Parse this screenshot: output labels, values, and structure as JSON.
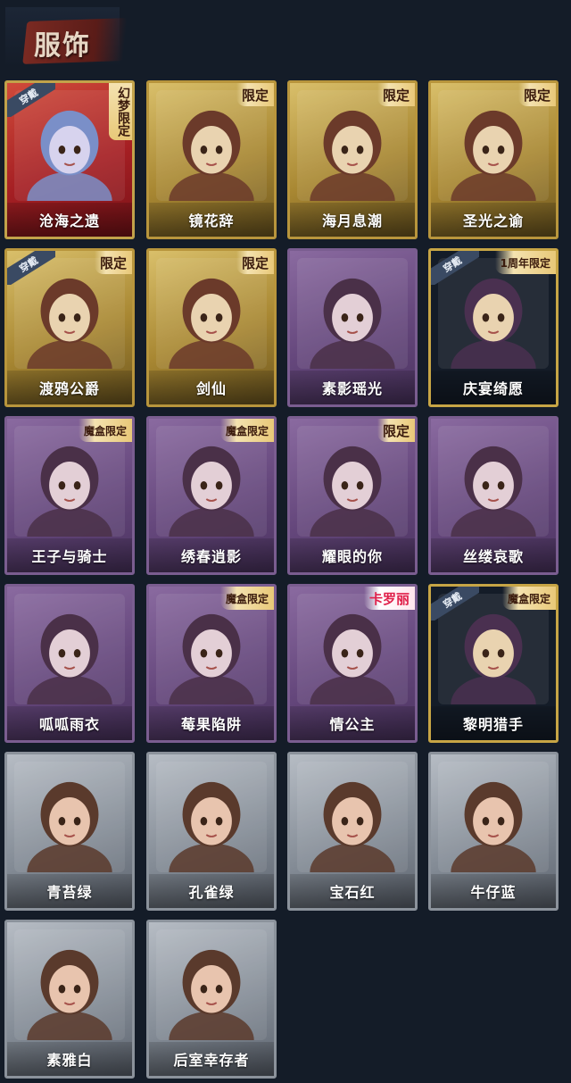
{
  "header": {
    "title": "服饰"
  },
  "colors": {
    "background": "#141c28",
    "red_card": "#a51f23",
    "gold_card": "#a88732",
    "purple_card": "#65477c",
    "gray_card": "#858d97"
  },
  "costumes": [
    {
      "name": "沧海之遗",
      "tag": "幻梦限定",
      "equipped_label": "穿戴",
      "style": "red"
    },
    {
      "name": "镜花辞",
      "tag": "限定",
      "style": "gold"
    },
    {
      "name": "海月息潮",
      "tag": "限定",
      "style": "gold"
    },
    {
      "name": "圣光之谕",
      "tag": "限定",
      "style": "gold"
    },
    {
      "name": "渡鸦公爵",
      "tag": "限定",
      "equipped_label": "穿戴",
      "style": "gold"
    },
    {
      "name": "剑仙",
      "tag": "限定",
      "style": "gold"
    },
    {
      "name": "素影瑶光",
      "style": "purple"
    },
    {
      "name": "庆宴绮愿",
      "tag": "1周年限定",
      "equipped_label": "穿戴",
      "style": "goldedge"
    },
    {
      "name": "王子与骑士",
      "tag": "魔盒限定",
      "style": "purple"
    },
    {
      "name": "绣春逍影",
      "tag": "魔盒限定",
      "style": "purple"
    },
    {
      "name": "耀眼的你",
      "tag": "限定",
      "style": "purple"
    },
    {
      "name": "丝缕哀歌",
      "style": "purple"
    },
    {
      "name": "呱呱雨衣",
      "style": "purple"
    },
    {
      "name": "莓果陷阱",
      "tag": "魔盒限定",
      "style": "purple"
    },
    {
      "name": "情公主",
      "tag": "卡罗丽",
      "style": "purple"
    },
    {
      "name": "黎明猎手",
      "tag": "魔盒限定",
      "equipped_label": "穿戴",
      "style": "goldedge"
    },
    {
      "name": "青苔绿",
      "style": "gray"
    },
    {
      "name": "孔雀绿",
      "style": "gray"
    },
    {
      "name": "宝石红",
      "style": "gray"
    },
    {
      "name": "牛仔蓝",
      "style": "gray"
    },
    {
      "name": "素雅白",
      "style": "gray"
    },
    {
      "name": "后室幸存者",
      "style": "gray"
    }
  ]
}
